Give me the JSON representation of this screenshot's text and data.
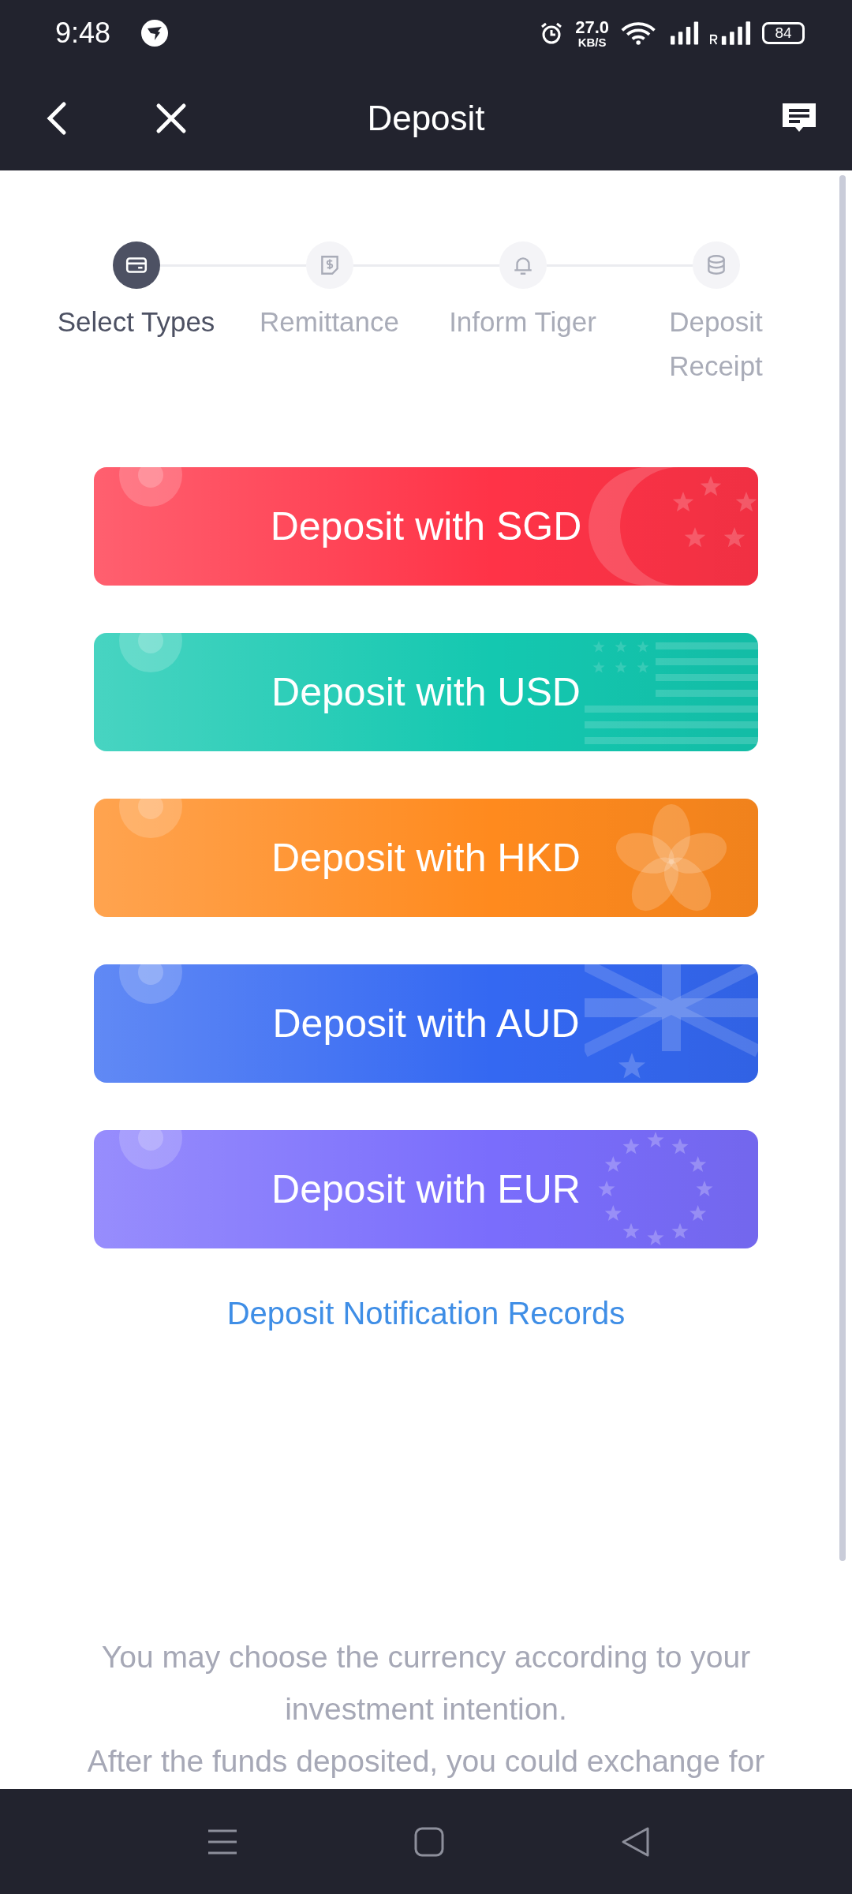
{
  "status_bar": {
    "time": "9:48",
    "net_speed": "27.0",
    "net_unit": "KB/S",
    "battery": "84"
  },
  "header": {
    "title": "Deposit"
  },
  "steps": [
    {
      "label": "Select Types",
      "active": true
    },
    {
      "label": "Remittance",
      "active": false
    },
    {
      "label": "Inform Tiger",
      "active": false
    },
    {
      "label": "Deposit Receipt",
      "active": false
    }
  ],
  "currency_buttons": [
    {
      "label": "Deposit with SGD",
      "kind": "sgd",
      "color": "#ff3347"
    },
    {
      "label": "Deposit with USD",
      "kind": "usd",
      "color": "#14c8b0"
    },
    {
      "label": "Deposit with HKD",
      "kind": "hkd",
      "color": "#ff8a1e"
    },
    {
      "label": "Deposit with AUD",
      "kind": "aud",
      "color": "#3468f2"
    },
    {
      "label": "Deposit with EUR",
      "kind": "eur",
      "color": "#7a6dfc"
    }
  ],
  "records_link": "Deposit Notification Records",
  "tips": [
    "You may choose the currency according to your investment intention.",
    "After the funds deposited, you could exchange for"
  ]
}
